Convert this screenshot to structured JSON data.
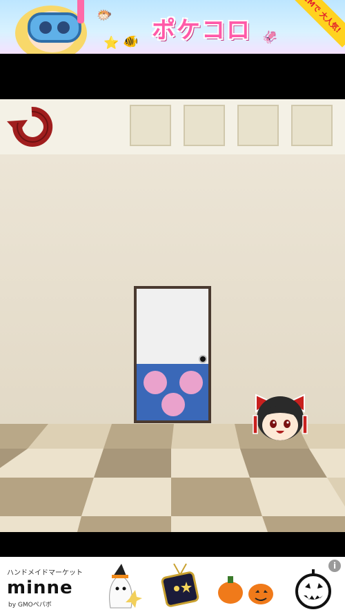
{
  "top_ad": {
    "logo_text": "ポケコロ",
    "corner_text": "CMで 大人気!"
  },
  "header": {
    "reset_icon": "reset-arrow-icon",
    "inventory_slots": [
      "",
      "",
      "",
      ""
    ]
  },
  "door": {
    "panel_color": "#3a68b8",
    "dot_color": "#eaa2cc"
  },
  "bottom_ad": {
    "tagline": "ハンドメイドマーケット",
    "brand": "minne",
    "byline": "by GMOペパボ",
    "info_icon": "i"
  },
  "colors": {
    "reset_arrow": "#a01e1e",
    "wall": "#e6ddcb",
    "floor_light": "#e3d6bd",
    "floor_dark": "#b7a585"
  }
}
